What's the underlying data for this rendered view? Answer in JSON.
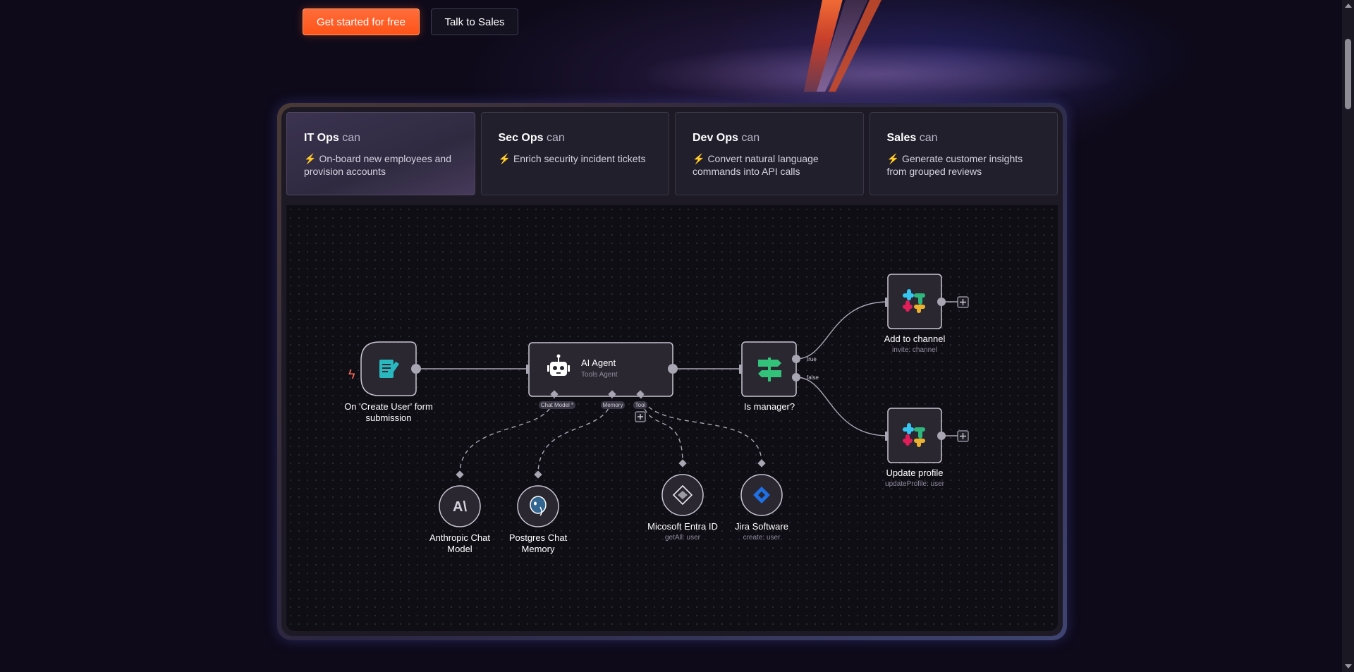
{
  "hero": {
    "primary_cta": "Get started for free",
    "secondary_cta": "Talk to Sales"
  },
  "tabs": [
    {
      "team": "IT Ops",
      "can": "can",
      "task": "On-board new employees and provision accounts",
      "active": true
    },
    {
      "team": "Sec Ops",
      "can": "can",
      "task": "Enrich security incident tickets",
      "active": false
    },
    {
      "team": "Dev Ops",
      "can": "can",
      "task": "Convert natural language commands into API calls",
      "active": false
    },
    {
      "team": "Sales",
      "can": "can",
      "task": "Generate customer insights from grouped reviews",
      "active": false
    }
  ],
  "workflow": {
    "trigger": {
      "line1": "On 'Create User' form",
      "line2": "submission",
      "icon": "form-icon"
    },
    "agent": {
      "title": "AI Agent",
      "subtitle": "Tools Agent",
      "icon": "robot-icon",
      "ports": {
        "chat_model": "Chat Model *",
        "memory": "Memory",
        "tool": "Tool"
      }
    },
    "branch": {
      "title": "Is manager?",
      "true_label": "true",
      "false_label": "false",
      "icon": "signpost-icon"
    },
    "slack_add": {
      "title": "Add to channel",
      "subtitle": "invite: channel",
      "icon": "slack-icon"
    },
    "slack_update": {
      "title": "Update profile",
      "subtitle": "updateProfile: user",
      "icon": "slack-icon"
    },
    "anthropic": {
      "line1": "Anthropic Chat",
      "line2": "Model",
      "icon": "anthropic-icon"
    },
    "postgres": {
      "line1": "Postgres Chat",
      "line2": "Memory",
      "icon": "postgres-icon"
    },
    "entra": {
      "title": "Micosoft Entra ID",
      "subtitle": "getAll: user",
      "icon": "entra-icon"
    },
    "jira": {
      "title": "Jira Software",
      "subtitle": "create: user",
      "icon": "jira-icon"
    }
  },
  "colors": {
    "primary_cta": "#ff5a1f",
    "trigger_icon": "#29b8c0",
    "branch_icon": "#33c27a",
    "jira": "#1f6fe5",
    "trigger_bolt": "#ff6d5a"
  }
}
